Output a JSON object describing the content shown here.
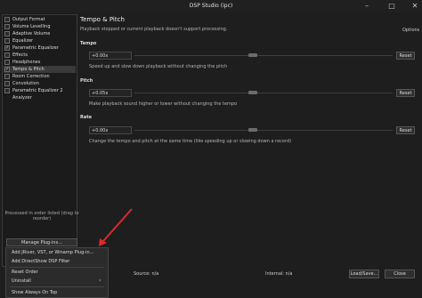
{
  "window": {
    "title": "DSP Studio (ipc)",
    "minimize_icon": "minimize-icon",
    "maximize_icon": "maximize-icon",
    "close_icon": "close-icon"
  },
  "plugins": [
    {
      "label": "Output Format",
      "checked": false
    },
    {
      "label": "Volume Levelling",
      "checked": false
    },
    {
      "label": "Adaptive Volume",
      "checked": false
    },
    {
      "label": "Equalizer",
      "checked": false
    },
    {
      "label": "Parametric Equalizer",
      "checked": true
    },
    {
      "label": "Effects",
      "checked": false
    },
    {
      "label": "Headphones",
      "checked": false
    },
    {
      "label": "Tempo & Pitch",
      "checked": true,
      "selected": true
    },
    {
      "label": "Room Correction",
      "checked": false
    },
    {
      "label": "Convolution",
      "checked": false
    },
    {
      "label": "Parametric Equalizer 2",
      "checked": false
    },
    {
      "label": "Analyzer",
      "checked": false,
      "indented": true
    }
  ],
  "left_panel": {
    "note": "Processed in order listed (drag to reorder)",
    "manage_button": "Manage Plug-ins..."
  },
  "context_menu": {
    "items": [
      "Add JRiver, VST, or Winamp Plug-in...",
      "Add DirectShow DSP Filter",
      "Reset Order",
      "Uninstall",
      "Show Always On Top"
    ],
    "uninstall_arrow_icon": "chevron-right-icon"
  },
  "main": {
    "title": "Tempo & Pitch",
    "subtitle": "Playback stopped or current playback doesn't support processing.",
    "options_label": "Options",
    "sections": [
      {
        "label": "Tempo",
        "value": "+0.00x",
        "description": "Speed up and slow down playback without changing the pitch",
        "reset": "Reset",
        "level": 0.46
      },
      {
        "label": "Pitch",
        "value": "+0.05x",
        "description": "Make playback sound higher or lower without changing the tempo",
        "reset": "Reset",
        "level": 0.46
      },
      {
        "label": "Rate",
        "value": "+0.00x",
        "description": "Change the tempo and pitch at the same time (like speeding up or slowing down a record)",
        "reset": "Reset",
        "level": 0.46
      }
    ]
  },
  "status": {
    "source": "Source: n/a",
    "internal": "Internal: n/a",
    "load_save": "Load/Save...",
    "close": "Close"
  },
  "annotation": {
    "arrow_color": "#d92b2b"
  }
}
